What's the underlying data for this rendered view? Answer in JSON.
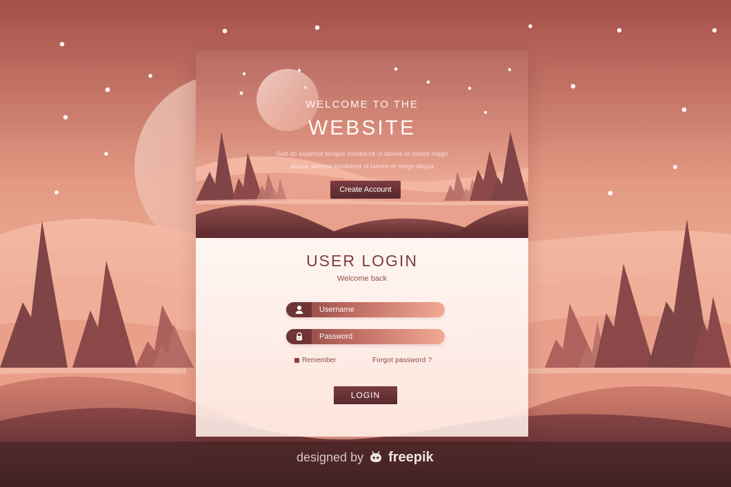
{
  "hero": {
    "line1": "WELCOME TO THE",
    "line2": "WEBSITE",
    "lorem": "Sed do eiusmod tempor incididunt ut labore et dolore magn aliqua, tempor incididunt ut labore et magn aliqua",
    "create_account_label": "Create Account"
  },
  "login": {
    "title": "USER LOGIN",
    "subtitle": "Welcome back",
    "username_placeholder": "Username",
    "password_placeholder": "Password",
    "remember_label": "Remember",
    "forgot_label": "Forgot password ?",
    "button_label": "LOGIN"
  },
  "credit": {
    "prefix": "designed by",
    "brand": "freepik"
  },
  "colors": {
    "accent": "#6f3436",
    "button": "#5d2b2f",
    "text": "#7b3d3c",
    "background_top": "#a84f49",
    "background_bottom": "#5a2b2b"
  },
  "icons": {
    "username": "user-icon",
    "password": "lock-icon",
    "brand": "freepik-logo-icon"
  }
}
